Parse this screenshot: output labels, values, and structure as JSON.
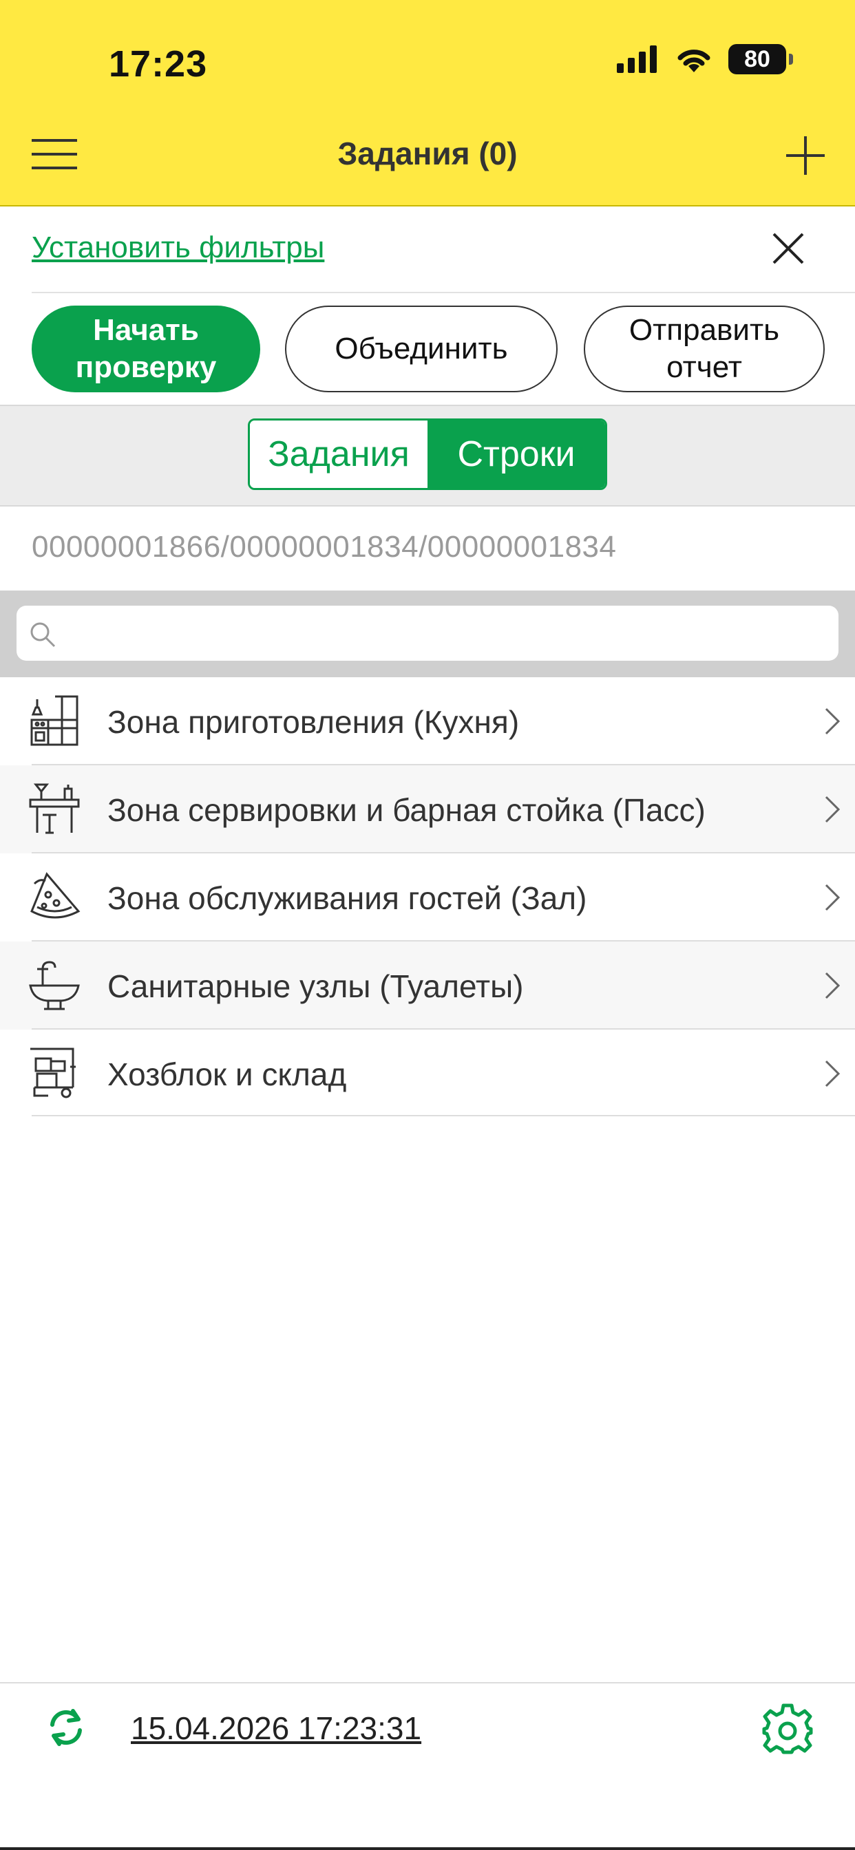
{
  "status_bar": {
    "time": "17:23",
    "battery": "80"
  },
  "header": {
    "title": "Задания (0)"
  },
  "filters": {
    "link": "Установить фильтры"
  },
  "actions": {
    "start": [
      "Начать",
      "проверку"
    ],
    "merge": "Объединить",
    "report": [
      "Отправить",
      "отчет"
    ]
  },
  "segments": {
    "tasks": "Задания",
    "rows": "Строки",
    "selected": "Строки"
  },
  "codes": "00000001866/00000001834/00000001834",
  "search": {
    "placeholder": ""
  },
  "zones": [
    {
      "label": "Зона приготовления (Кухня)",
      "icon": "kitchen-icon"
    },
    {
      "label": "Зона сервировки и барная стойка (Пасс)",
      "icon": "bar-counter-icon"
    },
    {
      "label": "Зона обслуживания гостей (Зал)",
      "icon": "pizza-icon"
    },
    {
      "label": "Санитарные узлы (Туалеты)",
      "icon": "sink-icon"
    },
    {
      "label": "Хозблок и склад",
      "icon": "warehouse-cart-icon"
    }
  ],
  "footer": {
    "datetime": "15.04.2026 17:23:31"
  },
  "colors": {
    "brand_yellow": "#FFE942",
    "accent_green": "#0aa14d"
  }
}
